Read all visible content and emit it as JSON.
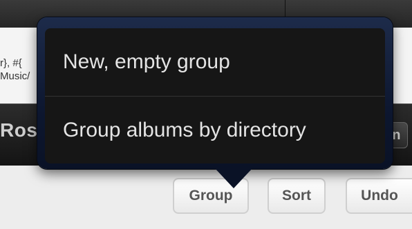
{
  "background": {
    "info_line1": "r}, #{",
    "info_line2": "Music/",
    "album_title": "Ros",
    "right_button_label": "on"
  },
  "toolbar": {
    "group_label": "Group",
    "sort_label": "Sort",
    "undo_label": "Undo"
  },
  "popover": {
    "items": [
      {
        "label": "New, empty group"
      },
      {
        "label": "Group albums by directory"
      }
    ]
  }
}
